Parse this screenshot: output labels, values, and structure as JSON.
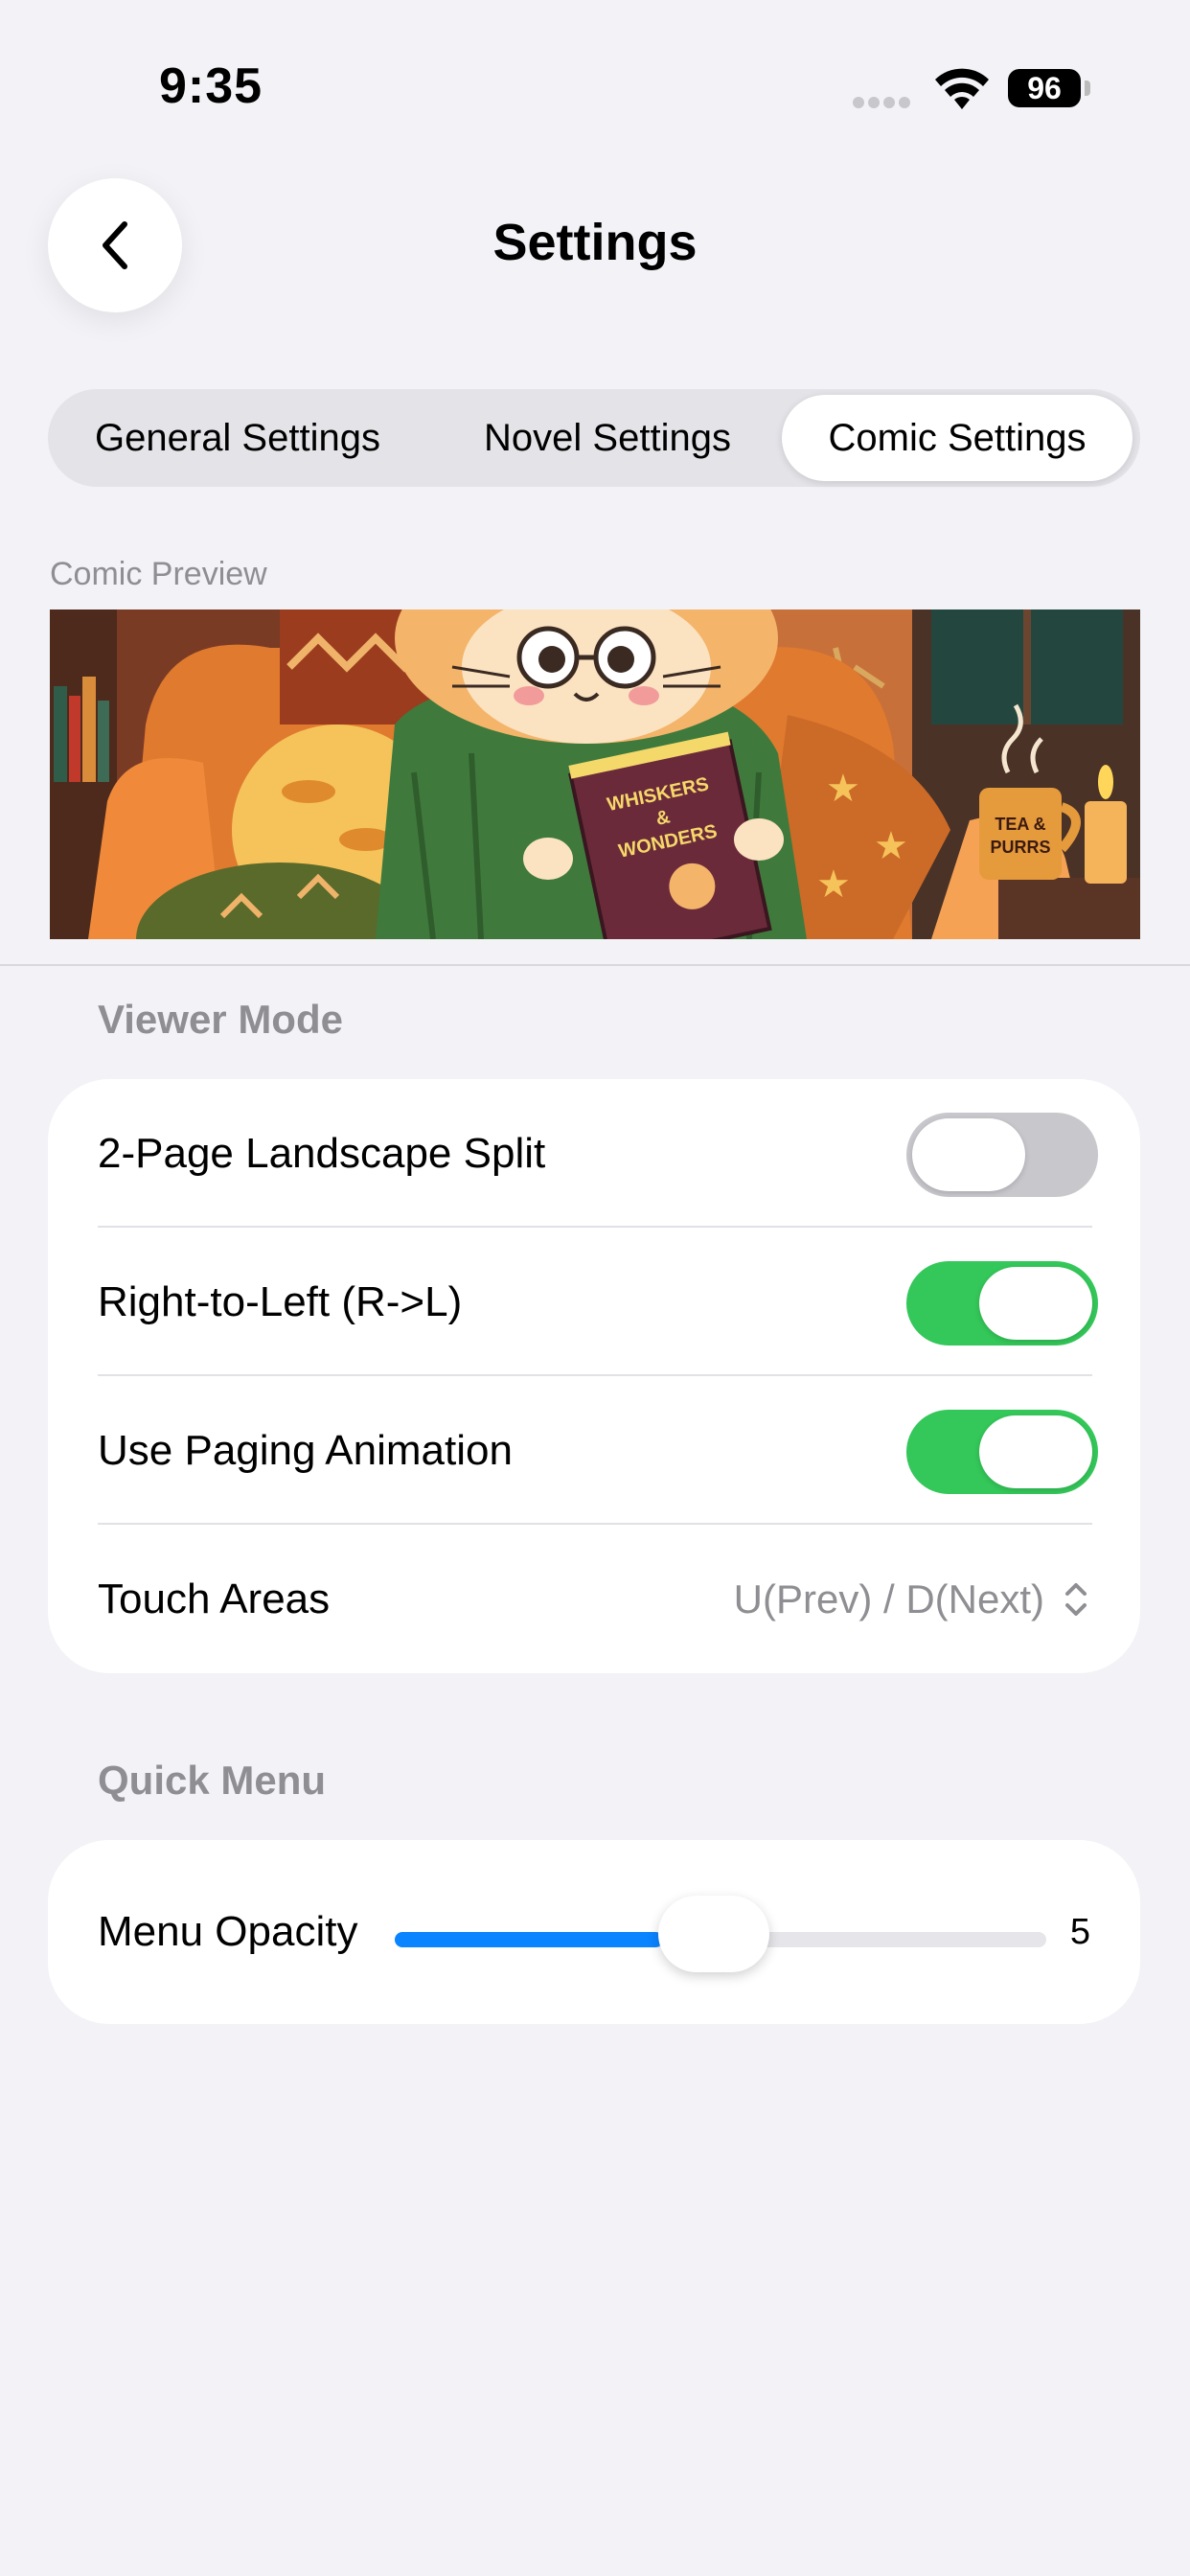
{
  "status": {
    "time": "9:35",
    "battery": "96"
  },
  "nav": {
    "title": "Settings"
  },
  "tabs": [
    {
      "label": "General Settings",
      "selected": false
    },
    {
      "label": "Novel Settings",
      "selected": false
    },
    {
      "label": "Comic Settings",
      "selected": true
    }
  ],
  "preview": {
    "label": "Comic Preview",
    "book_title_lines": [
      "WHISKERS",
      "&",
      "WONDERS"
    ],
    "mug_text_lines": [
      "TEA &",
      "PURRS"
    ]
  },
  "viewer_mode": {
    "header": "Viewer Mode",
    "rows": [
      {
        "label": "2-Page Landscape Split",
        "toggle": false
      },
      {
        "label": "Right-to-Left (R->L)",
        "toggle": true
      },
      {
        "label": "Use Paging Animation",
        "toggle": true
      },
      {
        "label": "Touch Areas",
        "value": "U(Prev) / D(Next)"
      }
    ]
  },
  "quick_menu": {
    "header": "Quick Menu",
    "opacity_label": "Menu Opacity",
    "opacity_value": "5",
    "opacity_fraction": 0.5
  },
  "colors": {
    "toggle_on": "#34c759",
    "toggle_off": "#c7c7cc",
    "slider_fill": "#0a84ff",
    "background": "#f2f2f7"
  }
}
